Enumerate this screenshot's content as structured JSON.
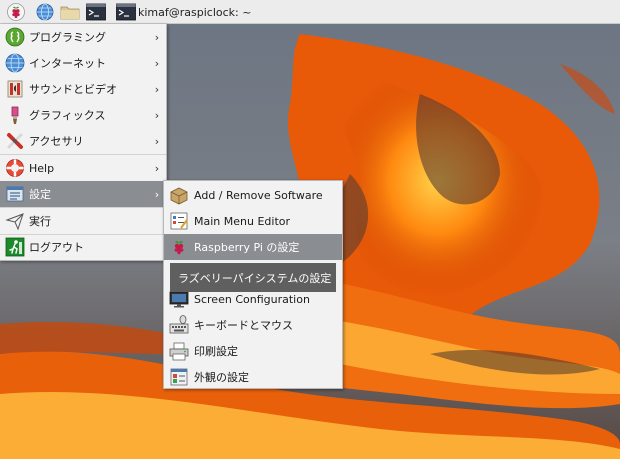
{
  "taskbar": {
    "icons": [
      "raspberry-icon",
      "globe-icon",
      "folder-icon",
      "terminal-icon"
    ],
    "task_title": "kimaf@raspiclock: ~"
  },
  "main_menu": {
    "items": [
      {
        "label": "プログラミング",
        "icon": "programming-icon",
        "has_submenu": true
      },
      {
        "label": "インターネット",
        "icon": "globe-icon",
        "has_submenu": true
      },
      {
        "label": "サウンドとビデオ",
        "icon": "sound-video-icon",
        "has_submenu": true
      },
      {
        "label": "グラフィックス",
        "icon": "graphics-icon",
        "has_submenu": true
      },
      {
        "label": "アクセサリ",
        "icon": "accessories-icon",
        "has_submenu": true
      },
      {
        "label": "Help",
        "icon": "help-icon",
        "has_submenu": true
      },
      {
        "label": "設定",
        "icon": "preferences-icon",
        "has_submenu": true
      },
      {
        "label": "実行",
        "icon": "run-icon",
        "has_submenu": false
      },
      {
        "label": "ログアウト",
        "icon": "logout-icon",
        "has_submenu": false
      }
    ],
    "arrow": "›"
  },
  "submenu": {
    "items": [
      {
        "label": "Add / Remove Software",
        "icon": "package-icon"
      },
      {
        "label": "Main Menu Editor",
        "icon": "menu-editor-icon"
      },
      {
        "label": "Raspberry Pi の設定",
        "icon": "raspberry-icon"
      },
      {
        "label": "Screen Configuration",
        "icon": "monitor-icon"
      },
      {
        "label": "キーボードとマウス",
        "icon": "keyboard-mouse-icon"
      },
      {
        "label": "印刷設定",
        "icon": "printer-icon"
      },
      {
        "label": "外観の設定",
        "icon": "appearance-icon"
      }
    ]
  },
  "tooltip": {
    "text": "ラズベリーパイシステムの設定"
  },
  "colors": {
    "highlight": "#8a8d92",
    "menu_bg": "#f2f2f2",
    "taskbar_bg": "#ececec"
  }
}
